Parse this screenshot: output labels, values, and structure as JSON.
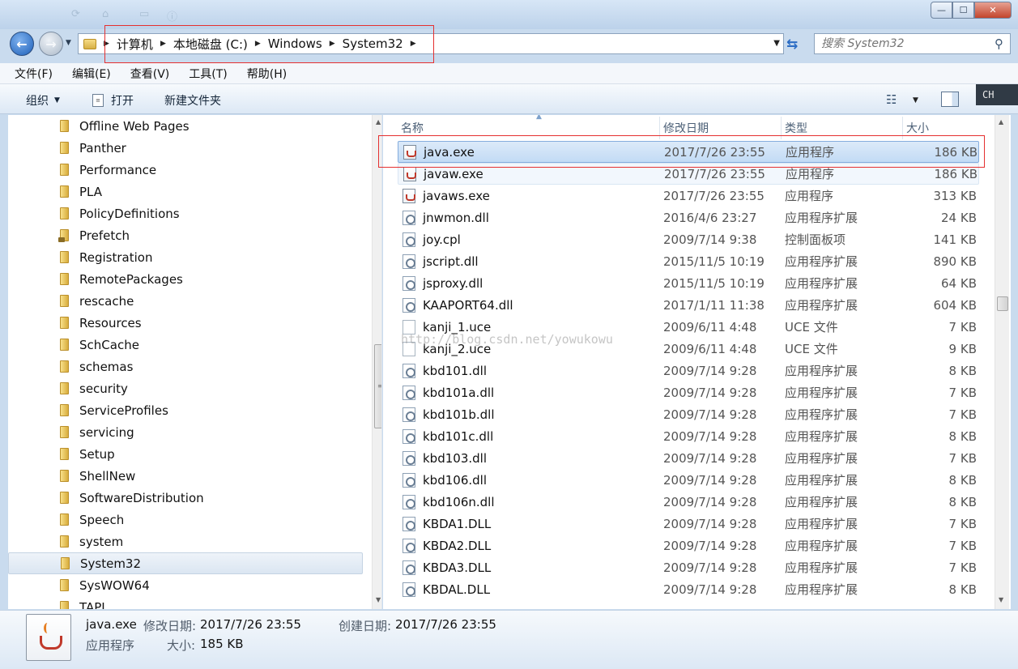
{
  "window": {
    "minimize_glyph": "—",
    "maximize_glyph": "☐",
    "close_glyph": "✕"
  },
  "nav": {
    "back_glyph": "←",
    "forward_glyph": "→",
    "breadcrumbs": [
      "计算机",
      "本地磁盘 (C:)",
      "Windows",
      "System32"
    ],
    "search_placeholder": "搜索 System32"
  },
  "menu": [
    "文件(F)",
    "编辑(E)",
    "查看(V)",
    "工具(T)",
    "帮助(H)"
  ],
  "toolbar": {
    "organize_label": "组织",
    "open_label": "打开",
    "new_folder_label": "新建文件夹"
  },
  "ime": "CH",
  "tree": [
    {
      "name": "Offline Web Pages"
    },
    {
      "name": "Panther"
    },
    {
      "name": "Performance"
    },
    {
      "name": "PLA"
    },
    {
      "name": "PolicyDefinitions"
    },
    {
      "name": "Prefetch",
      "locked": true
    },
    {
      "name": "Registration"
    },
    {
      "name": "RemotePackages"
    },
    {
      "name": "rescache"
    },
    {
      "name": "Resources"
    },
    {
      "name": "SchCache"
    },
    {
      "name": "schemas"
    },
    {
      "name": "security"
    },
    {
      "name": "ServiceProfiles"
    },
    {
      "name": "servicing"
    },
    {
      "name": "Setup"
    },
    {
      "name": "ShellNew"
    },
    {
      "name": "SoftwareDistribution"
    },
    {
      "name": "Speech"
    },
    {
      "name": "system"
    },
    {
      "name": "System32",
      "selected": true
    },
    {
      "name": "SysWOW64"
    },
    {
      "name": "TAPI"
    }
  ],
  "columns": {
    "name": "名称",
    "date": "修改日期",
    "type": "类型",
    "size": "大小"
  },
  "files": [
    {
      "name": "java.exe",
      "date": "2017/7/26 23:55",
      "type": "应用程序",
      "size": "186 KB",
      "icon": "java",
      "state": "selected"
    },
    {
      "name": "javaw.exe",
      "date": "2017/7/26 23:55",
      "type": "应用程序",
      "size": "186 KB",
      "icon": "java",
      "state": "hover"
    },
    {
      "name": "javaws.exe",
      "date": "2017/7/26 23:55",
      "type": "应用程序",
      "size": "313 KB",
      "icon": "java"
    },
    {
      "name": "jnwmon.dll",
      "date": "2016/4/6 23:27",
      "type": "应用程序扩展",
      "size": "24 KB",
      "icon": "dll"
    },
    {
      "name": "joy.cpl",
      "date": "2009/7/14 9:38",
      "type": "控制面板项",
      "size": "141 KB",
      "icon": "dll"
    },
    {
      "name": "jscript.dll",
      "date": "2015/11/5 10:19",
      "type": "应用程序扩展",
      "size": "890 KB",
      "icon": "dll"
    },
    {
      "name": "jsproxy.dll",
      "date": "2015/11/5 10:19",
      "type": "应用程序扩展",
      "size": "64 KB",
      "icon": "dll"
    },
    {
      "name": "KAAPORT64.dll",
      "date": "2017/1/11 11:38",
      "type": "应用程序扩展",
      "size": "604 KB",
      "icon": "dll"
    },
    {
      "name": "kanji_1.uce",
      "date": "2009/6/11 4:48",
      "type": "UCE 文件",
      "size": "7 KB",
      "icon": "uce"
    },
    {
      "name": "kanji_2.uce",
      "date": "2009/6/11 4:48",
      "type": "UCE 文件",
      "size": "9 KB",
      "icon": "uce"
    },
    {
      "name": "kbd101.dll",
      "date": "2009/7/14 9:28",
      "type": "应用程序扩展",
      "size": "8 KB",
      "icon": "dll"
    },
    {
      "name": "kbd101a.dll",
      "date": "2009/7/14 9:28",
      "type": "应用程序扩展",
      "size": "7 KB",
      "icon": "dll"
    },
    {
      "name": "kbd101b.dll",
      "date": "2009/7/14 9:28",
      "type": "应用程序扩展",
      "size": "7 KB",
      "icon": "dll"
    },
    {
      "name": "kbd101c.dll",
      "date": "2009/7/14 9:28",
      "type": "应用程序扩展",
      "size": "8 KB",
      "icon": "dll"
    },
    {
      "name": "kbd103.dll",
      "date": "2009/7/14 9:28",
      "type": "应用程序扩展",
      "size": "7 KB",
      "icon": "dll"
    },
    {
      "name": "kbd106.dll",
      "date": "2009/7/14 9:28",
      "type": "应用程序扩展",
      "size": "8 KB",
      "icon": "dll"
    },
    {
      "name": "kbd106n.dll",
      "date": "2009/7/14 9:28",
      "type": "应用程序扩展",
      "size": "8 KB",
      "icon": "dll"
    },
    {
      "name": "KBDA1.DLL",
      "date": "2009/7/14 9:28",
      "type": "应用程序扩展",
      "size": "7 KB",
      "icon": "dll"
    },
    {
      "name": "KBDA2.DLL",
      "date": "2009/7/14 9:28",
      "type": "应用程序扩展",
      "size": "7 KB",
      "icon": "dll"
    },
    {
      "name": "KBDA3.DLL",
      "date": "2009/7/14 9:28",
      "type": "应用程序扩展",
      "size": "7 KB",
      "icon": "dll"
    },
    {
      "name": "KBDAL.DLL",
      "date": "2009/7/14 9:28",
      "type": "应用程序扩展",
      "size": "8 KB",
      "icon": "dll"
    }
  ],
  "watermark": "http://blog.csdn.net/yowukowu",
  "details": {
    "name": "java.exe",
    "modified_label": "修改日期:",
    "modified_value": "2017/7/26 23:55",
    "created_label": "创建日期:",
    "created_value": "2017/7/26 23:55",
    "type": "应用程序",
    "size_label": "大小:",
    "size_value": "185 KB"
  },
  "colors": {
    "highlight_box": "#e53030",
    "selection": "#c2dbf5",
    "chrome": "#c9dbee"
  }
}
